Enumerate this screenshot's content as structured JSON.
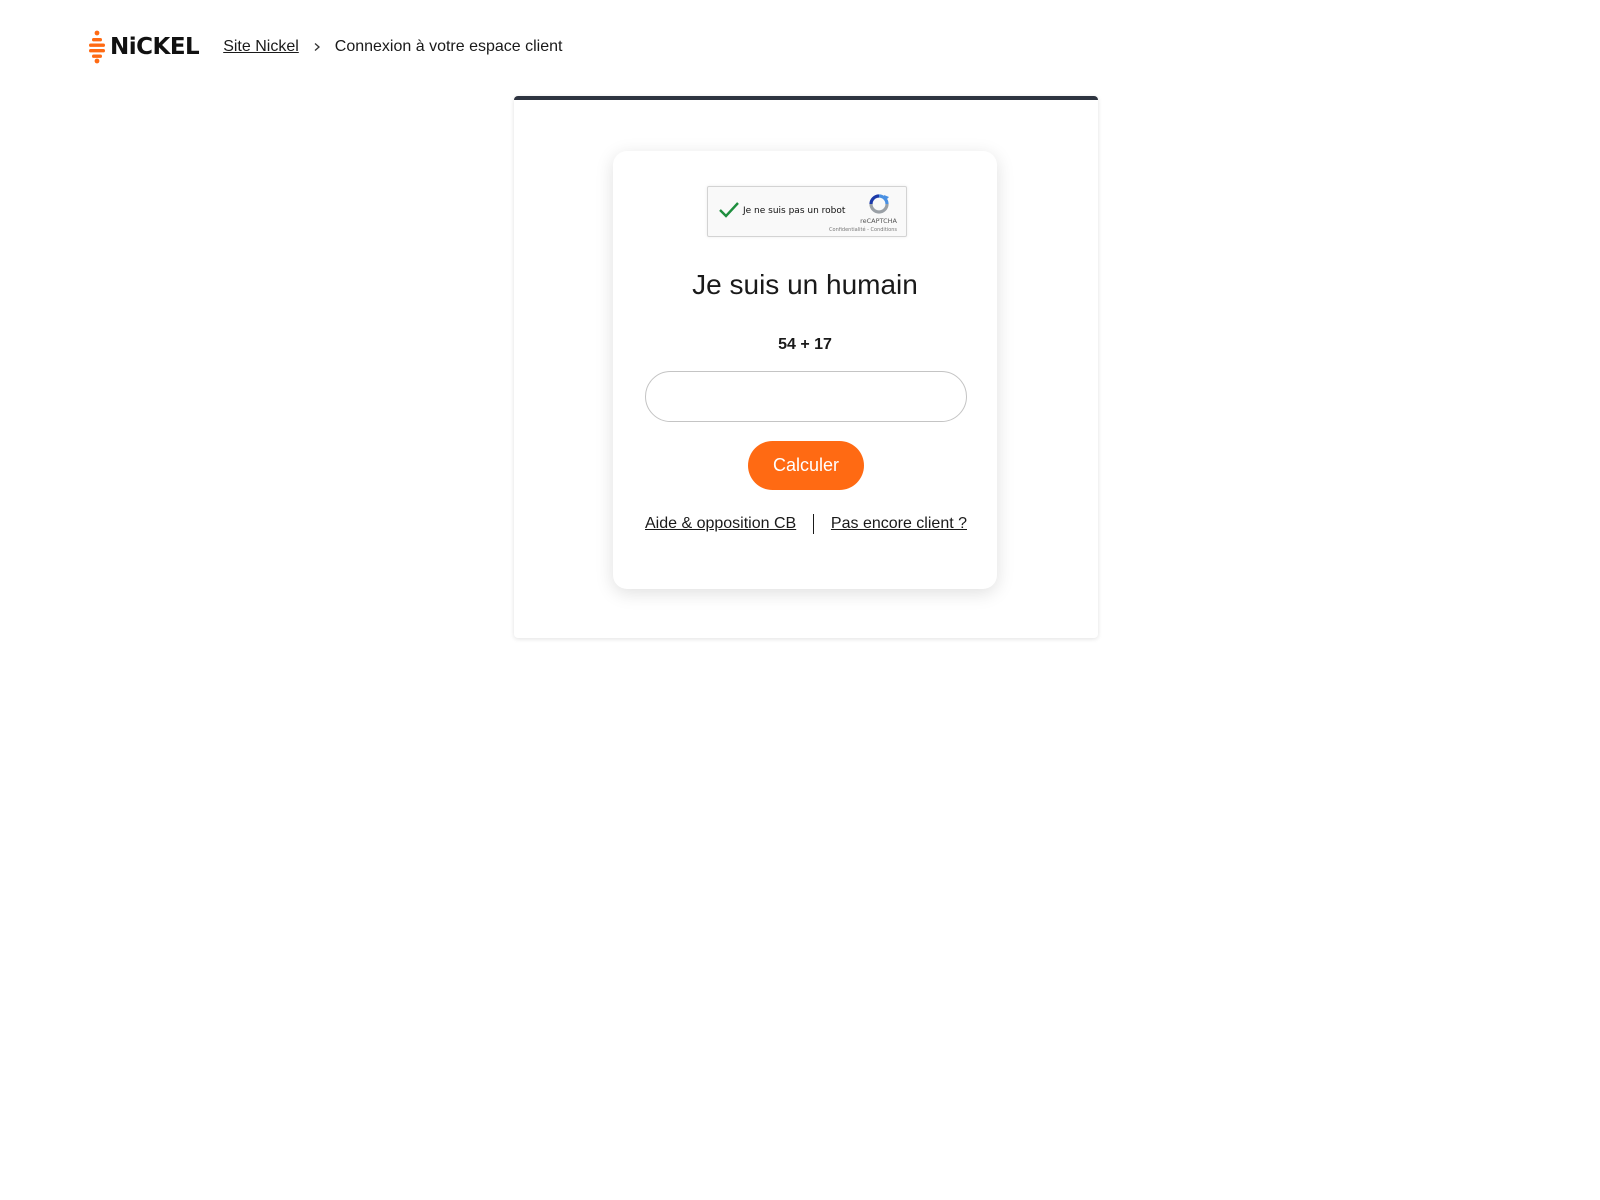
{
  "header": {
    "logo_text": "NiCKEL",
    "breadcrumb": {
      "home_link": "Site Nickel",
      "current": "Connexion à votre espace client"
    }
  },
  "recaptcha": {
    "label": "Je ne suis pas un robot",
    "brand": "reCAPTCHA",
    "terms": "Confidentialité - Conditions",
    "checked": true
  },
  "challenge": {
    "title": "Je suis un humain",
    "question": "54 + 17",
    "answer_value": "",
    "button_label": "Calculer"
  },
  "links": {
    "help": "Aide & opposition CB",
    "signup": "Pas encore client ?"
  },
  "colors": {
    "accent": "#ff6a13",
    "card_border": "#2e3440",
    "check": "#1e8e3e",
    "recaptcha_blue": "#4a90e2"
  },
  "icons": [
    "nickel-logo-icon",
    "chevron-right-icon",
    "checkmark-icon",
    "recaptcha-logo-icon"
  ]
}
